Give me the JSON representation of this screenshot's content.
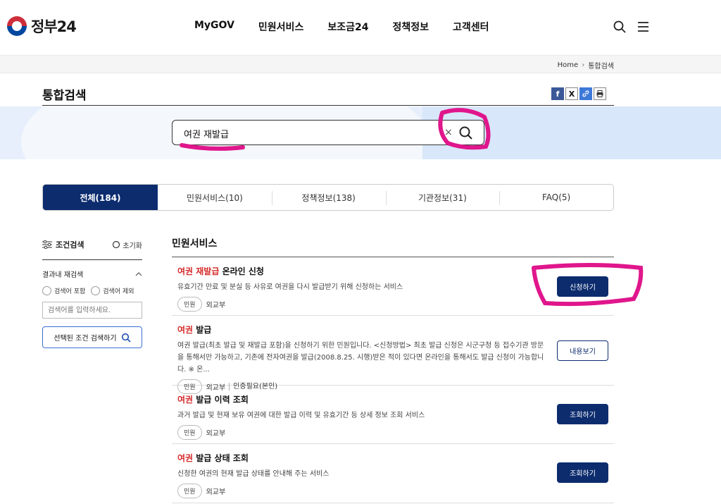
{
  "header": {
    "logo_text": "정부24",
    "nav": [
      "MyGOV",
      "민원서비스",
      "보조금24",
      "정책정보",
      "고객센터"
    ]
  },
  "breadcrumb": {
    "home": "Home",
    "current": "통합검색"
  },
  "page": {
    "title": "통합검색"
  },
  "search": {
    "value": "여권 재발급",
    "clear_symbol": "×"
  },
  "tabs": [
    {
      "label": "전체(184)",
      "active": true
    },
    {
      "label": "민원서비스(10)"
    },
    {
      "label": "정책정보(138)"
    },
    {
      "label": "기관정보(31)"
    },
    {
      "label": "FAQ(5)"
    }
  ],
  "sidebar": {
    "title": "조건검색",
    "reset": "초기화",
    "refine_title": "결과내 재검색",
    "include": "검색어 포함",
    "exclude": "검색어 제외",
    "input_placeholder": "검색어를 입력하세요.",
    "submit": "선택된 조건 검색하기"
  },
  "results": {
    "section_title": "민원서비스",
    "items": [
      {
        "title_hl": "여권 재발급",
        "title_rest": " 온라인 신청",
        "desc": "유효기간 만료 및 분실 등 사유로 여권을 다시 발급받기 위해 신청하는 서비스",
        "tag": "민원",
        "org": "외교부",
        "extra": "",
        "action": "신청하기",
        "action_style": "primary"
      },
      {
        "title_hl": "여권",
        "title_rest": " 발급",
        "desc": "여권 발급(최초 발급 및 재발급 포함)을 신청하기 위한 민원입니다. <신청방법> 최초 발급 신청은 시군구청 등 접수기관 방문을 통해서만 가능하고, 기존에 전자여권을 발급(2008.8.25. 시행)받은 적이 있다면 온라인을 통해서도 발급 신청이 가능합니다. ※ 온...",
        "tag": "민원",
        "org": "외교부",
        "extra": "인증필요(본인)",
        "action": "내용보기",
        "action_style": "outline"
      },
      {
        "title_hl": "여권",
        "title_rest": " 발급 이력 조회",
        "desc": "과거 발급 및 현재 보유 여권에 대한 발급 이력 및 유효기간 등 상세 정보 조회 서비스",
        "tag": "민원",
        "org": "외교부",
        "extra": "",
        "action": "조회하기",
        "action_style": "primary"
      },
      {
        "title_hl": "여권",
        "title_rest": " 발급 상태 조회",
        "desc": "신청한 여권의 현재 발급 상태를 안내해 주는 서비스",
        "tag": "민원",
        "org": "외교부",
        "extra": "",
        "action": "조회하기",
        "action_style": "primary"
      }
    ]
  },
  "colors": {
    "primary": "#0c2c6e",
    "highlight": "#d62b2b",
    "annotation": "#e0168c"
  }
}
